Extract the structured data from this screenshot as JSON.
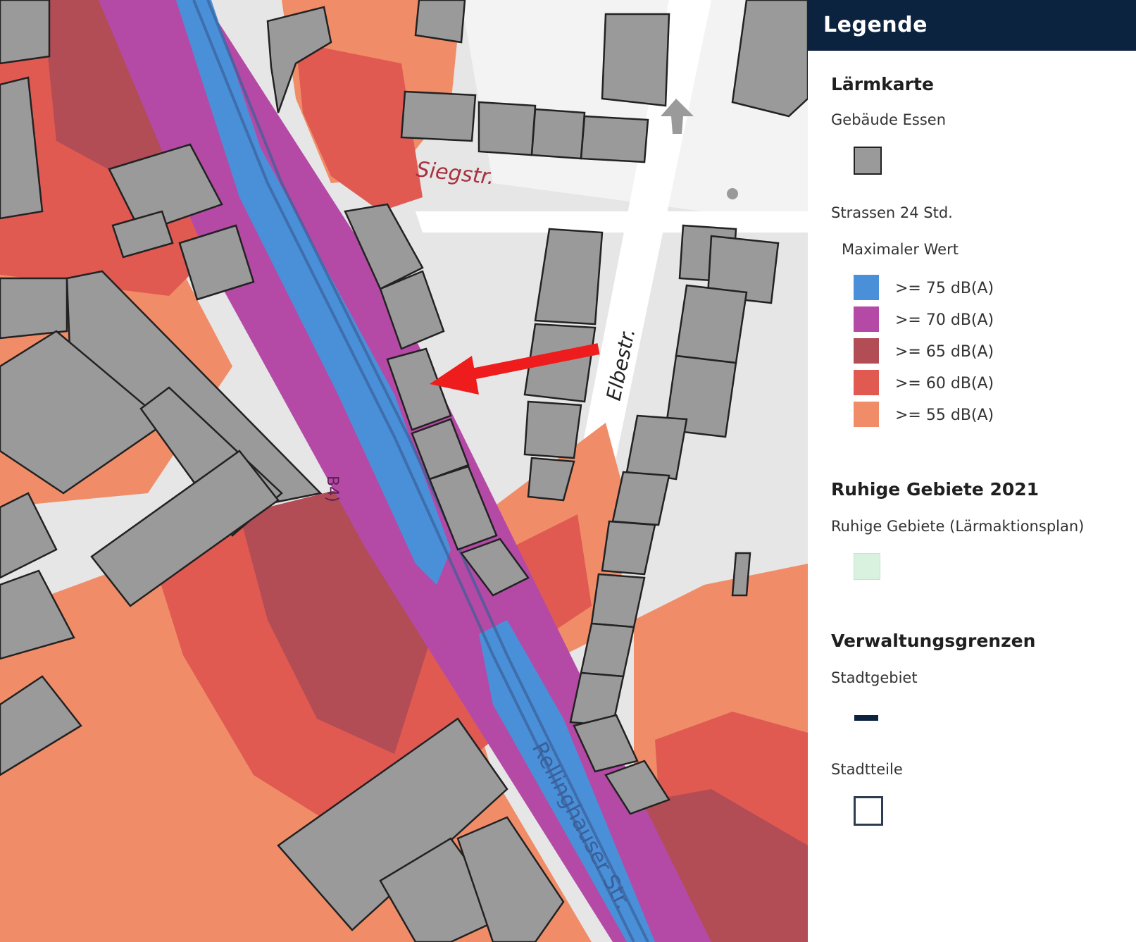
{
  "map": {
    "street_labels": [
      "Siegstr.",
      "Elbestr.",
      "Rellinghauser Str.",
      "B4)"
    ]
  },
  "legend": {
    "title": "Legende",
    "sections": [
      {
        "heading": "Lärmkarte",
        "layers": [
          {
            "label": "Gebäude Essen",
            "swatch_color": "#9a9a9a"
          },
          {
            "label": "Strassen 24 Std.",
            "sublabel": "Maximaler Wert",
            "classes": [
              {
                "label": ">= 75 dB(A)",
                "color": "#4a90d9"
              },
              {
                "label": ">= 70 dB(A)",
                "color": "#b44aa6"
              },
              {
                "label": ">= 65 dB(A)",
                "color": "#b24c55"
              },
              {
                "label": ">= 60 dB(A)",
                "color": "#e05a52"
              },
              {
                "label": ">= 55 dB(A)",
                "color": "#f08d68"
              }
            ]
          }
        ]
      },
      {
        "heading": "Ruhige Gebiete 2021",
        "layers": [
          {
            "label": "Ruhige Gebiete (Lärmaktionsplan)",
            "swatch_color": "#d9f2df"
          }
        ]
      },
      {
        "heading": "Verwaltungsgrenzen",
        "layers": [
          {
            "label": "Stadtgebiet",
            "swatch_color": "#0c2340"
          },
          {
            "label": "Stadtteile",
            "swatch_color": "#ffffff"
          }
        ]
      }
    ]
  }
}
